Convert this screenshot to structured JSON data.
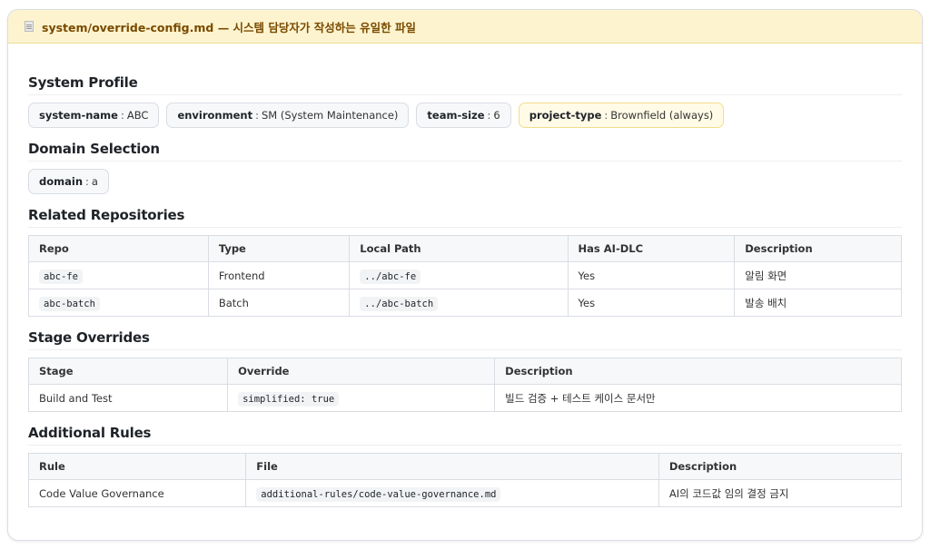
{
  "header": {
    "title": "system/override-config.md — 시스템 담당자가 작성하는 유일한 파일",
    "icon": "file-icon"
  },
  "system_profile": {
    "heading": "System Profile",
    "chips": [
      {
        "key": "system-name",
        "value": "ABC"
      },
      {
        "key": "environment",
        "value": "SM (System Maintenance)"
      },
      {
        "key": "team-size",
        "value": "6"
      },
      {
        "key": "project-type",
        "value": "Brownfield (always)"
      }
    ]
  },
  "domain_selection": {
    "heading": "Domain Selection",
    "chips": [
      {
        "key": "domain",
        "value": "a"
      }
    ]
  },
  "related_repos": {
    "heading": "Related Repositories",
    "columns": [
      "Repo",
      "Type",
      "Local Path",
      "Has AI-DLC",
      "Description"
    ],
    "rows": [
      {
        "repo": "abc-fe",
        "type": "Frontend",
        "path": "../abc-fe",
        "has_aidlc": "Yes",
        "description": "알림 화면"
      },
      {
        "repo": "abc-batch",
        "type": "Batch",
        "path": "../abc-batch",
        "has_aidlc": "Yes",
        "description": "발송 배치"
      }
    ]
  },
  "stage_overrides": {
    "heading": "Stage Overrides",
    "columns": [
      "Stage",
      "Override",
      "Description"
    ],
    "rows": [
      {
        "stage": "Build and Test",
        "override": "simplified: true",
        "description": "빌드 검증 + 테스트 케이스 문서만"
      }
    ]
  },
  "additional_rules": {
    "heading": "Additional Rules",
    "columns": [
      "Rule",
      "File",
      "Description"
    ],
    "rows": [
      {
        "rule": "Code Value Governance",
        "file": "additional-rules/code-value-governance.md",
        "description": "AI의 코드값 임의 결정 금지"
      }
    ]
  },
  "colors": {
    "header_bg": "#fdf4cf",
    "header_text": "#7a4a00",
    "highlight_chip_bg": "#fffbe6",
    "border": "#d9dde3"
  }
}
